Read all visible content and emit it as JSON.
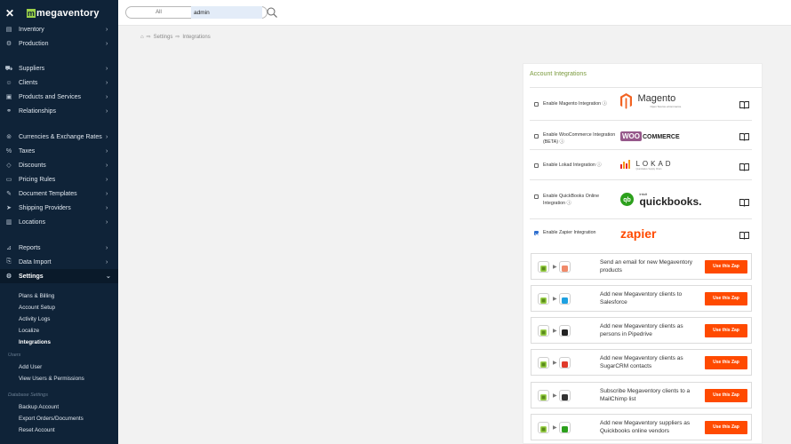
{
  "app": {
    "logo_text": "megaventory"
  },
  "search": {
    "scope": "All",
    "value": "admin"
  },
  "breadcrumb": [
    "Settings",
    "Integrations"
  ],
  "sidebar": {
    "items": [
      {
        "label": "Inventory",
        "icon": "inventory-icon"
      },
      {
        "label": "Production",
        "icon": "production-icon"
      },
      {
        "label": "Suppliers",
        "icon": "truck-icon"
      },
      {
        "label": "Clients",
        "icon": "clients-icon"
      },
      {
        "label": "Products and Services",
        "icon": "box-icon"
      },
      {
        "label": "Relationships",
        "icon": "relationships-icon"
      },
      {
        "label": "Currencies & Exchange Rates",
        "icon": "currency-icon"
      },
      {
        "label": "Taxes",
        "icon": "percent-icon"
      },
      {
        "label": "Discounts",
        "icon": "tag-icon"
      },
      {
        "label": "Pricing Rules",
        "icon": "pricing-icon"
      },
      {
        "label": "Document Templates",
        "icon": "pencil-icon"
      },
      {
        "label": "Shipping Providers",
        "icon": "send-icon"
      },
      {
        "label": "Locations",
        "icon": "building-icon"
      },
      {
        "label": "Reports",
        "icon": "chart-icon"
      },
      {
        "label": "Data Import",
        "icon": "import-icon"
      },
      {
        "label": "Settings",
        "icon": "gear-icon"
      }
    ],
    "settings_sub": [
      "Plans & Billing",
      "Account Setup",
      "Activity Logs",
      "Localize",
      "Integrations"
    ],
    "users_group": "Users",
    "users_sub": [
      "Add User",
      "View Users & Permissions"
    ],
    "db_group": "Database Settings",
    "db_sub": [
      "Backup Account",
      "Export Orders/Documents",
      "Reset Account"
    ]
  },
  "panel": {
    "title": "Account Integrations",
    "rows": [
      {
        "label": "Enable Magento Integration",
        "checked": false,
        "logo": "Magento",
        "logo_sub": "Open Source eCommerce"
      },
      {
        "label": "Enable WooCommerce Integration (BETA)",
        "checked": false,
        "logo_a": "WOO",
        "logo_b": "COMMERCE"
      },
      {
        "label": "Enable Lokad Integration",
        "checked": false,
        "logo": "LOKAD",
        "logo_sub": "Quantitative Supply Chain"
      },
      {
        "label": "Enable QuickBooks Online Integration",
        "checked": false,
        "logo_a": "intuit",
        "logo_b": "quickbooks."
      },
      {
        "label": "Enable Zapier Integration",
        "checked": true,
        "logo": "zapier"
      }
    ]
  },
  "zaps": [
    {
      "text": "Send an email for new Megaventory products",
      "button": "Use this Zap",
      "app_icon": "email-icon",
      "app_color": "#f08a6a"
    },
    {
      "text": "Add new Megaventory clients to Salesforce",
      "button": "Use this Zap",
      "app_icon": "salesforce-icon",
      "app_color": "#1ea1e1"
    },
    {
      "text": "Add new Megaventory clients as persons in Pipedrive",
      "button": "Use this Zap",
      "app_icon": "pipedrive-icon",
      "app_color": "#222222"
    },
    {
      "text": "Add new Megaventory clients as SugarCRM contacts",
      "button": "Use this Zap",
      "app_icon": "sugarcrm-icon",
      "app_color": "#e03a2b"
    },
    {
      "text": "Subscribe Megaventory clients to a MailChimp list",
      "button": "Use this Zap",
      "app_icon": "mailchimp-icon",
      "app_color": "#333333"
    },
    {
      "text": "Add new Megaventory suppliers as Quickbooks online vendors",
      "button": "Use this Zap",
      "app_icon": "quickbooks-icon",
      "app_color": "#2ca01c"
    }
  ],
  "colors": {
    "sidebar_bg": "#0f2338",
    "accent_green": "#9bd14a",
    "zap_orange": "#ff4a00",
    "panel_title": "#7a9a3d"
  }
}
